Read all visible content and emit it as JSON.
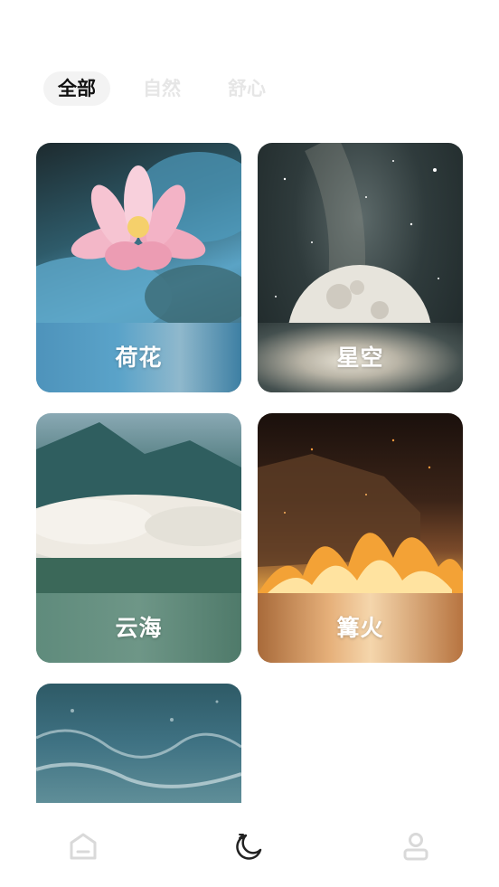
{
  "tabs": [
    {
      "label": "全部",
      "active": true
    },
    {
      "label": "自然",
      "active": false
    },
    {
      "label": "舒心",
      "active": false
    }
  ],
  "cards": [
    {
      "title": "荷花",
      "image": "lotus-photo"
    },
    {
      "title": "星空",
      "image": "starry-sky-photo"
    },
    {
      "title": "云海",
      "image": "sea-of-clouds-photo"
    },
    {
      "title": "篝火",
      "image": "bonfire-photo"
    },
    {
      "title": "",
      "image": "ocean-photo"
    }
  ],
  "bottom_nav": [
    {
      "icon": "home-icon",
      "active": false
    },
    {
      "icon": "moon-sleep-icon",
      "active": true
    },
    {
      "icon": "profile-icon",
      "active": false
    }
  ],
  "colors": {
    "active_tab_text": "#111111",
    "inactive_tab_text": "#e6e6e6",
    "active_tab_bg": "#f3f3f3",
    "nav_active": "#222222",
    "nav_inactive": "#d9d9d9"
  }
}
